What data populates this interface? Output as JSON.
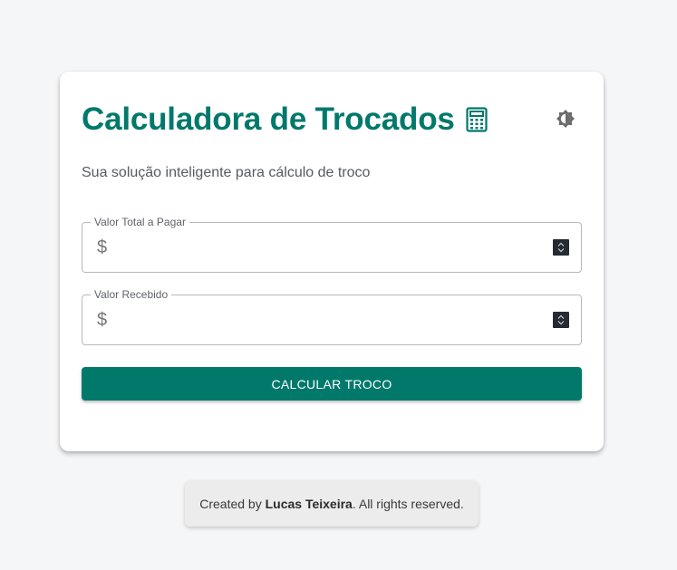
{
  "header": {
    "title": "Calculadora de Trocados",
    "subtitle": "Sua solução inteligente para cálculo de troco"
  },
  "form": {
    "total_label": "Valor Total a Pagar",
    "total_value": "",
    "received_label": "Valor Recebido",
    "received_value": "",
    "currency_prefix": "$",
    "submit_label": "CALCULAR TROCO"
  },
  "footer": {
    "prefix": "Created by ",
    "author": "Lucas Teixeira",
    "suffix": ". All rights reserved."
  },
  "colors": {
    "accent": "#00796b",
    "background": "#f5f6f8",
    "card": "#ffffff"
  },
  "icons": {
    "title_icon": "calculator-icon",
    "theme_toggle": "brightness-icon"
  }
}
